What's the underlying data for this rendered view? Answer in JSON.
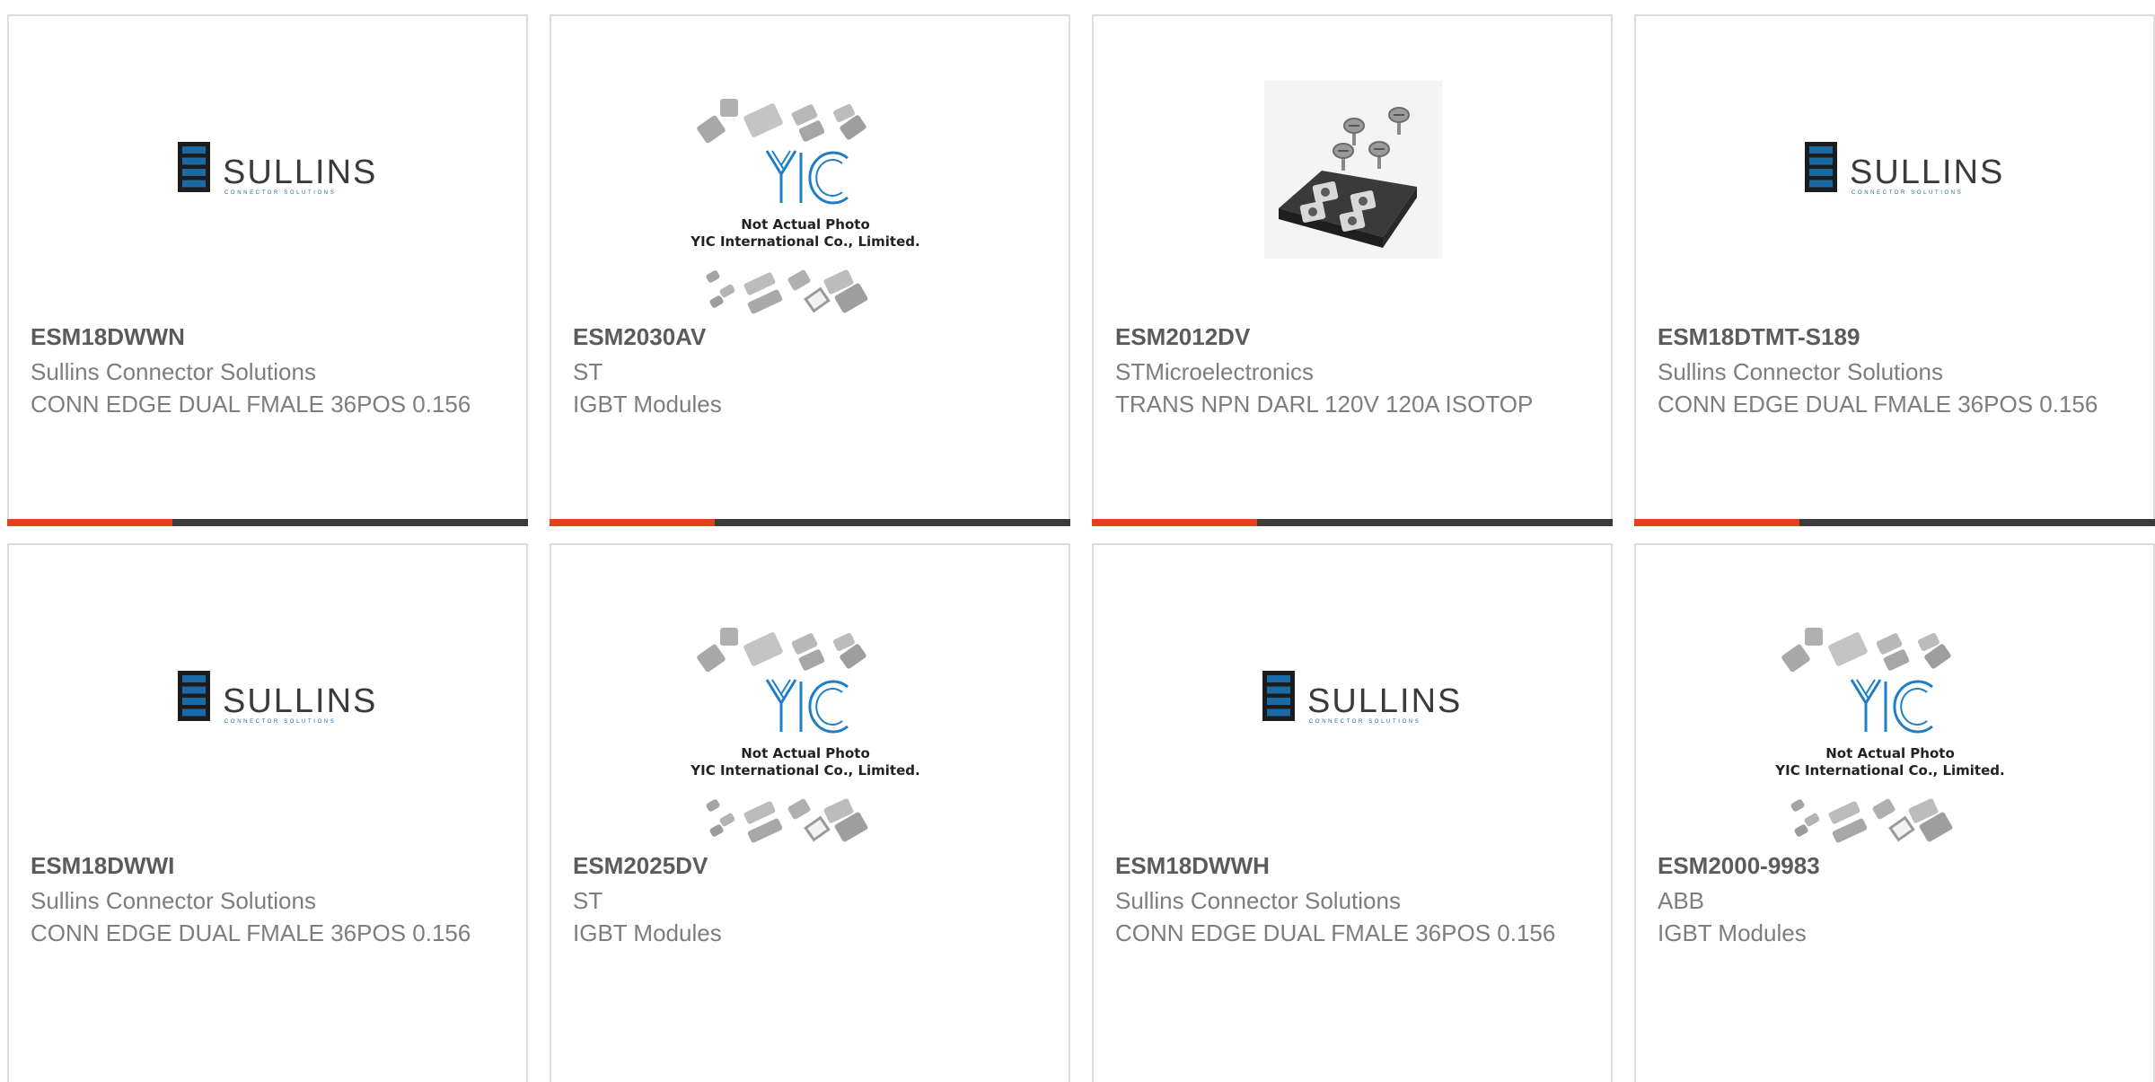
{
  "products": [
    {
      "part_number": "ESM18DWWN",
      "manufacturer": "Sullins Connector Solutions",
      "description": "CONN EDGE DUAL FMALE 36POS 0.156",
      "image": {
        "type": "sullins-logo",
        "brand": "SULLINS",
        "tagline": "CONNECTOR SOLUTIONS"
      }
    },
    {
      "part_number": "ESM2030AV",
      "manufacturer": "ST",
      "description": "IGBT Modules",
      "image": {
        "type": "yic-placeholder",
        "brand": "YIC",
        "line1": "Not Actual Photo",
        "line2": "YIC International Co., Limited."
      }
    },
    {
      "part_number": "ESM2012DV",
      "manufacturer": "STMicroelectronics",
      "description": "TRANS NPN DARL 120V 120A ISOTOP",
      "image": {
        "type": "isotop-module-photo"
      }
    },
    {
      "part_number": "ESM18DTMT-S189",
      "manufacturer": "Sullins Connector Solutions",
      "description": "CONN EDGE DUAL FMALE 36POS 0.156",
      "image": {
        "type": "sullins-logo",
        "brand": "SULLINS",
        "tagline": "CONNECTOR SOLUTIONS"
      }
    },
    {
      "part_number": "ESM18DWWI",
      "manufacturer": "Sullins Connector Solutions",
      "description": "CONN EDGE DUAL FMALE 36POS 0.156",
      "image": {
        "type": "sullins-logo",
        "brand": "SULLINS",
        "tagline": "CONNECTOR SOLUTIONS"
      }
    },
    {
      "part_number": "ESM2025DV",
      "manufacturer": "ST",
      "description": "IGBT Modules",
      "image": {
        "type": "yic-placeholder",
        "brand": "YIC",
        "line1": "Not Actual Photo",
        "line2": "YIC International Co., Limited."
      }
    },
    {
      "part_number": "ESM18DWWH",
      "manufacturer": "Sullins Connector Solutions",
      "description": "CONN EDGE DUAL FMALE 36POS 0.156",
      "image": {
        "type": "sullins-logo",
        "brand": "SULLINS",
        "tagline": "CONNECTOR SOLUTIONS"
      }
    },
    {
      "part_number": "ESM2000-9983",
      "manufacturer": "ABB",
      "description": "IGBT Modules",
      "image": {
        "type": "yic-placeholder",
        "brand": "YIC",
        "line1": "Not Actual Photo",
        "line2": "YIC International Co., Limited."
      }
    }
  ],
  "colors": {
    "accent": "#e4401c",
    "bar": "#3b3b3b",
    "border": "#dcdcdc",
    "part_number": "#5b5b5b",
    "text": "#7d7d7d",
    "sullins_blue": "#1a6aa5",
    "yic_blue": "#1e7fc4"
  }
}
